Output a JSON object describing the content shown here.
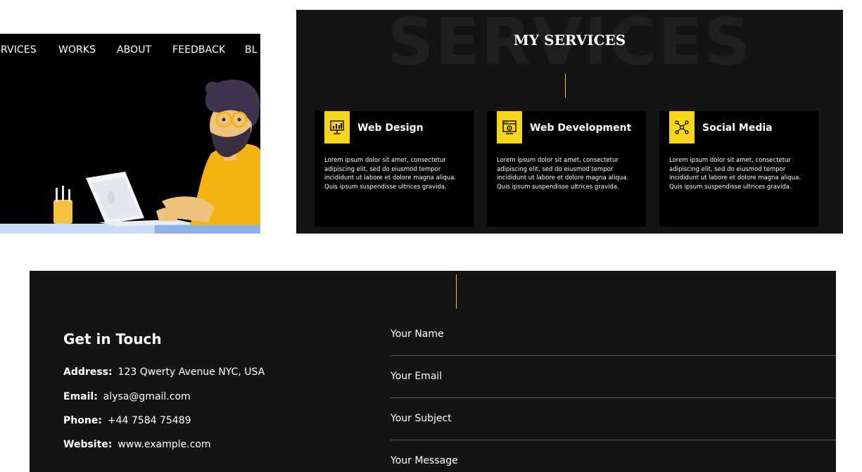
{
  "nav": {
    "items": [
      "ERVICES",
      "WORKS",
      "ABOUT",
      "FEEDBACK",
      "BL"
    ]
  },
  "services": {
    "background_word": "SERVICES",
    "title": "MY SERVICES",
    "accent_color": "#f6d51a",
    "cards": [
      {
        "icon": "monitor-chart-icon",
        "title": "Web Design",
        "text": "Lorem ipsum dolor sit amet, consectetur adipiscing elit, sed do eiusmod tempor incididunt ut labore et dolore magna aliqua. Quis ipsum suspendisse ultrices gravida."
      },
      {
        "icon": "browser-code-icon",
        "title": "Web Development",
        "text": "Lorem ipsum dolor sit amet, consectetur adipiscing elit, sed do eiusmod tempor incididunt ut labore et dolore magna aliqua. Quis ipsum suspendisse ultrices gravida."
      },
      {
        "icon": "network-nodes-icon",
        "title": "Social Media",
        "text": "Lorem ipsum dolor sit amet, consectetur adipiscing elit, sed do eiusmod tempor incididunt ut labore et dolore magna aliqua. Quis ipsum suspendisse ultrices gravida."
      }
    ]
  },
  "contact": {
    "heading": "Get in Touch",
    "address_label": "Address:",
    "address_value": "123 Qwerty Avenue NYC, USA",
    "email_label": "Email:",
    "email_value": "alysa@gmail.com",
    "phone_label": "Phone:",
    "phone_value": "+44 7584 75489",
    "website_label": "Website:",
    "website_value": "www.example.com",
    "form": {
      "name_placeholder": "Your Name",
      "email_placeholder": "Your Email",
      "subject_placeholder": "Your Subject",
      "message_placeholder": "Your Message"
    }
  }
}
